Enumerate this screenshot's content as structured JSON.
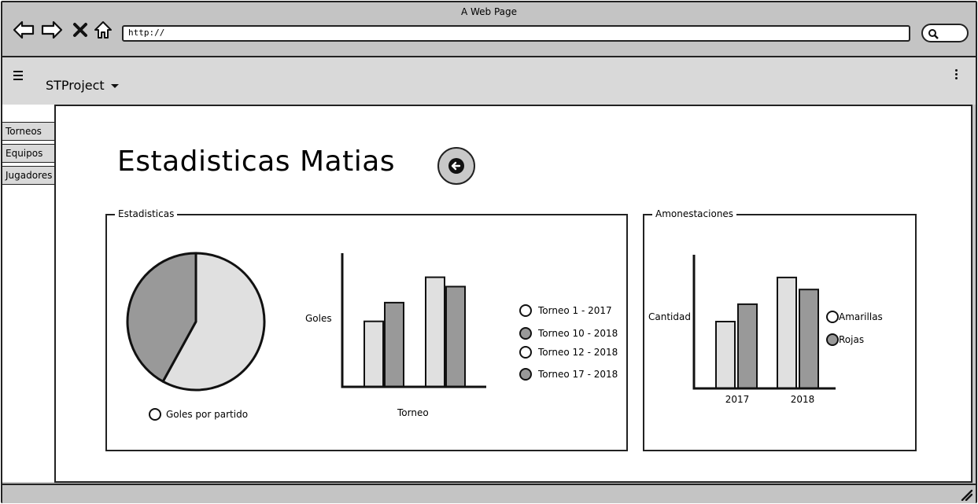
{
  "window": {
    "title": "A Web Page"
  },
  "browser": {
    "url": "http://"
  },
  "appbar": {
    "project_name": "STProject"
  },
  "sidebar": {
    "items": [
      {
        "label": "Torneos"
      },
      {
        "label": "Equipos"
      },
      {
        "label": "Jugadores"
      }
    ]
  },
  "main": {
    "title": "Estadisticas Matias"
  },
  "colors": {
    "light": "#e0e0e0",
    "dark": "#999999",
    "outline": "#111111"
  },
  "stats_panel": {
    "legend_title": "Estadisticas",
    "pie_legend": "Goles por partido",
    "bar_ylabel": "Goles",
    "bar_xlabel": "Torneo",
    "series_legend": [
      {
        "label": "Torneo 1 - 2017",
        "filled": false
      },
      {
        "label": "Torneo 10 - 2018",
        "filled": true
      },
      {
        "label": "Torneo 12 - 2018",
        "filled": false
      },
      {
        "label": "Torneo 17 - 2018",
        "filled": true
      }
    ]
  },
  "amon_panel": {
    "legend_title": "Amonestaciones",
    "ylabel": "Cantidad",
    "legend": [
      {
        "label": "Amarillas",
        "filled": false
      },
      {
        "label": "Rojas",
        "filled": true
      }
    ]
  },
  "chart_data": [
    {
      "type": "pie",
      "values": [
        58,
        42
      ],
      "colors": [
        "#e0e0e0",
        "#999999"
      ],
      "legend": "Goles por partido"
    },
    {
      "type": "bar",
      "ylabel": "Goles",
      "xlabel": "Torneo",
      "ylim": [
        0,
        100
      ],
      "values": [
        49,
        63,
        82,
        75
      ],
      "colors": [
        "#e0e0e0",
        "#999999",
        "#e0e0e0",
        "#999999"
      ],
      "legend": [
        "Torneo 1 - 2017",
        "Torneo 10 - 2018",
        "Torneo 12 - 2018",
        "Torneo 17 - 2018"
      ]
    },
    {
      "type": "bar",
      "ylabel": "Cantidad",
      "categories": [
        "2017",
        "2018"
      ],
      "ylim": [
        0,
        100
      ],
      "series": [
        {
          "name": "Amarillas",
          "values": [
            50,
            83
          ],
          "color": "#e0e0e0"
        },
        {
          "name": "Rojas",
          "values": [
            63,
            74
          ],
          "color": "#999999"
        }
      ]
    }
  ]
}
